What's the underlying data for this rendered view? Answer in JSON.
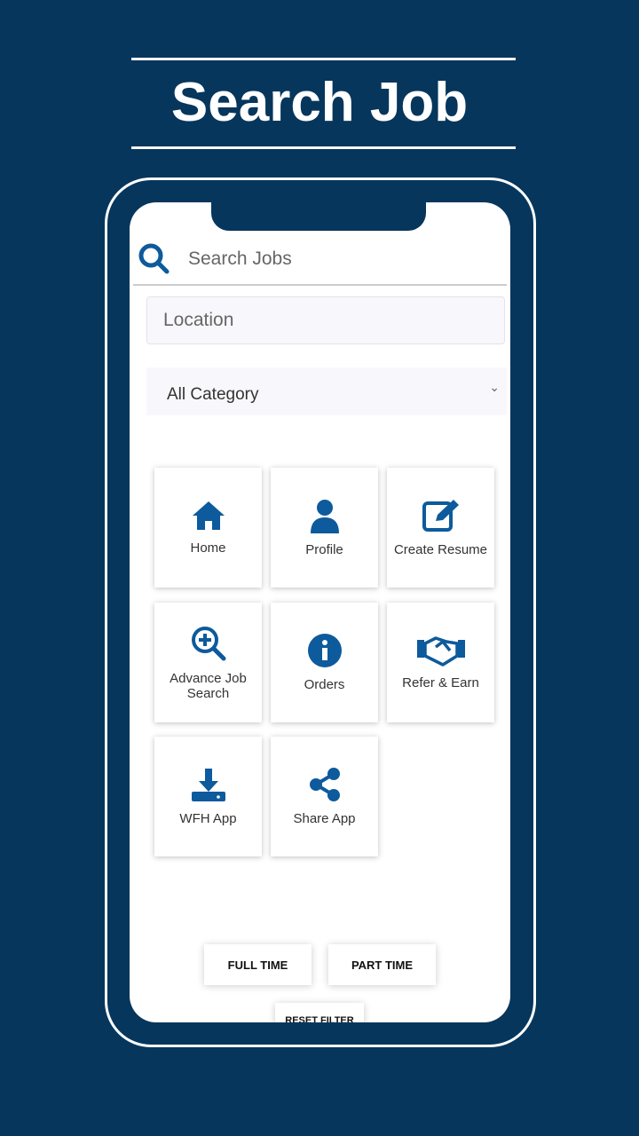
{
  "header": {
    "title": "Search Job"
  },
  "search": {
    "placeholder": "Search Jobs",
    "location_placeholder": "Location",
    "category": "All Category"
  },
  "menu": [
    {
      "label": "Home",
      "icon": "home-icon"
    },
    {
      "label": "Profile",
      "icon": "user-icon"
    },
    {
      "label": "Create Resume",
      "icon": "edit-icon"
    },
    {
      "label": "Advance Job Search",
      "icon": "zoom-in-icon"
    },
    {
      "label": "Orders",
      "icon": "info-icon"
    },
    {
      "label": "Refer & Earn",
      "icon": "handshake-icon"
    },
    {
      "label": "WFH App",
      "icon": "download-icon"
    },
    {
      "label": "Share App",
      "icon": "share-icon"
    }
  ],
  "filters": {
    "full_time": "FULL TIME",
    "part_time": "PART TIME",
    "reset": "RESET FILTER"
  },
  "colors": {
    "background": "#06365c",
    "accent": "#0d5a9c"
  }
}
